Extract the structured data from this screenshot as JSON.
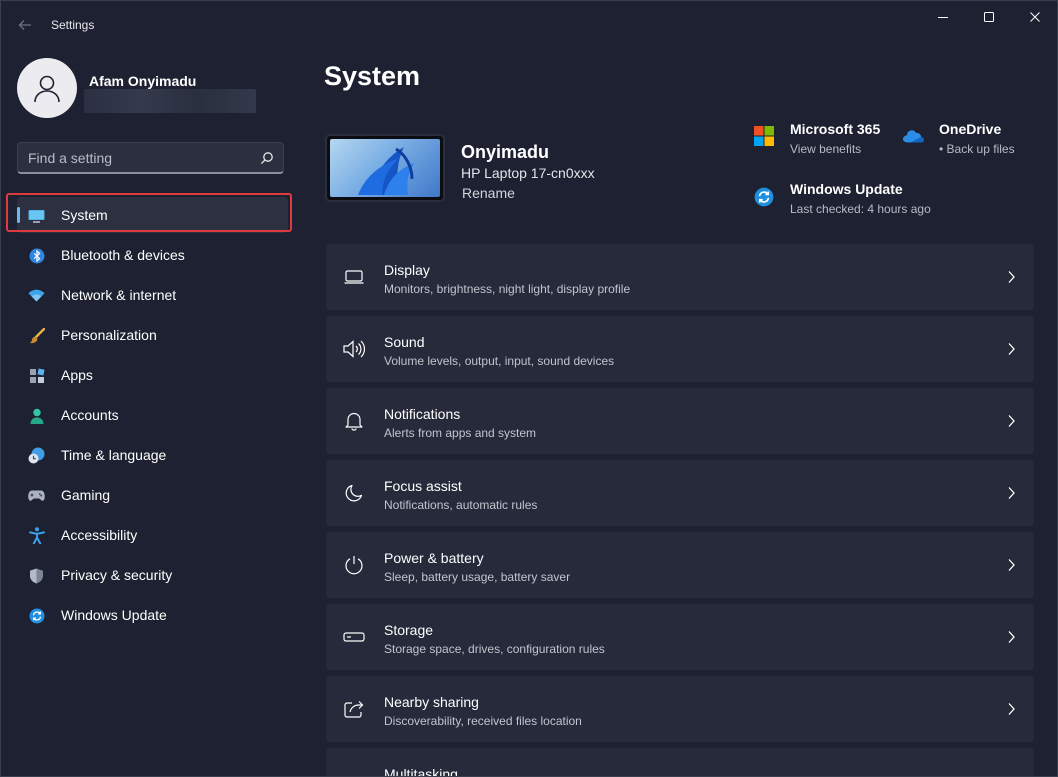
{
  "titlebar": {
    "app_title": "Settings"
  },
  "profile": {
    "name": "Afam Onyimadu"
  },
  "search": {
    "placeholder": "Find a setting"
  },
  "sidebar": {
    "items": [
      {
        "label": "System",
        "icon": "monitor-icon",
        "active": true
      },
      {
        "label": "Bluetooth & devices",
        "icon": "bluetooth-icon"
      },
      {
        "label": "Network & internet",
        "icon": "wifi-icon"
      },
      {
        "label": "Personalization",
        "icon": "brush-icon"
      },
      {
        "label": "Apps",
        "icon": "apps-icon"
      },
      {
        "label": "Accounts",
        "icon": "person-icon"
      },
      {
        "label": "Time & language",
        "icon": "globe-clock-icon"
      },
      {
        "label": "Gaming",
        "icon": "gamepad-icon"
      },
      {
        "label": "Accessibility",
        "icon": "accessibility-icon"
      },
      {
        "label": "Privacy & security",
        "icon": "shield-icon"
      },
      {
        "label": "Windows Update",
        "icon": "update-icon"
      }
    ]
  },
  "main": {
    "title": "System",
    "device": {
      "name": "Onyimadu",
      "model": "HP Laptop 17-cn0xxx",
      "rename": "Rename"
    },
    "quick": {
      "microsoft365": {
        "title": "Microsoft 365",
        "sub": "View benefits"
      },
      "onedrive": {
        "title": "OneDrive",
        "sub": "• Back up files"
      },
      "windows_update": {
        "title": "Windows Update",
        "sub": "Last checked: 4 hours ago"
      }
    },
    "cards": [
      {
        "title": "Display",
        "sub": "Monitors, brightness, night light, display profile",
        "icon": "display-icon"
      },
      {
        "title": "Sound",
        "sub": "Volume levels, output, input, sound devices",
        "icon": "speaker-icon"
      },
      {
        "title": "Notifications",
        "sub": "Alerts from apps and system",
        "icon": "bell-icon"
      },
      {
        "title": "Focus assist",
        "sub": "Notifications, automatic rules",
        "icon": "moon-icon"
      },
      {
        "title": "Power & battery",
        "sub": "Sleep, battery usage, battery saver",
        "icon": "power-icon"
      },
      {
        "title": "Storage",
        "sub": "Storage space, drives, configuration rules",
        "icon": "storage-icon"
      },
      {
        "title": "Nearby sharing",
        "sub": "Discoverability, received files location",
        "icon": "share-icon"
      },
      {
        "title": "Multitasking",
        "sub": "",
        "icon": "multitask-icon"
      }
    ]
  },
  "colors": {
    "background": "#1d2131",
    "card": "#262a3a",
    "accent": "#6cb8f0",
    "highlight": "#e0393e"
  }
}
